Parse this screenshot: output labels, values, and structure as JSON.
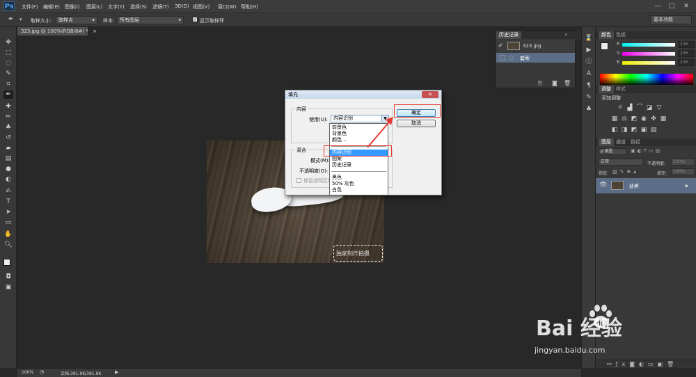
{
  "app": {
    "logo": "Ps",
    "menu": [
      "文件(F)",
      "编辑(E)",
      "图像(I)",
      "图层(L)",
      "文字(Y)",
      "选择(S)",
      "滤镜(T)",
      "3D(D)",
      "视图(V)",
      "窗口(W)",
      "帮助(H)"
    ],
    "window_controls": [
      "—",
      "□",
      "✕"
    ]
  },
  "options_bar": {
    "sample_size_label": "取样大小:",
    "sample_size_value": "取样点",
    "sample_label": "样本:",
    "sample_value": "所有图层",
    "show_ring_label": "显示取样环",
    "show_ring_checked": true,
    "workspace": "基本功能"
  },
  "document": {
    "tab_label": "323.jpg @ 100%(RGB/8#) *",
    "tab_close": "×",
    "image_watermark": "独家制作拍摄"
  },
  "history_panel": {
    "tab": "历史记录",
    "snapshot": "323.jpg",
    "items": [
      "套索"
    ]
  },
  "color_panel": {
    "tabs": [
      "颜色",
      "色板"
    ],
    "channels": [
      {
        "label": "R",
        "value": "236"
      },
      {
        "label": "G",
        "value": "236"
      },
      {
        "label": "B",
        "value": "236"
      }
    ]
  },
  "adjustments_panel": {
    "tabs": [
      "调整",
      "样式"
    ],
    "title": "添加调整"
  },
  "layers_panel": {
    "tabs": [
      "图层",
      "通道",
      "路径"
    ],
    "kind_label": "p 类型",
    "blend_mode": "正常",
    "opacity_label": "不透明度:",
    "opacity_value": "100%",
    "lock_label": "锁定:",
    "fill_label": "填充:",
    "fill_value": "100%",
    "layer_name": "背景"
  },
  "status_bar": {
    "zoom": "100%",
    "doc_info": "文档:391.9K/391.9K"
  },
  "fill_dialog": {
    "title": "填充",
    "close": "✕",
    "content_group": "内容",
    "use_label": "使用(U):",
    "use_value": "内容识别",
    "blend_group": "混合",
    "mode_label": "模式(M):",
    "opacity_label": "不透明度(O):",
    "preserve_label": "保留透明区域",
    "ok_button": "确定",
    "cancel_button": "取消",
    "dropdown_options": [
      "前景色",
      "背景色",
      "颜色...",
      "内容识别",
      "图案",
      "历史记录",
      "黑色",
      "50% 灰色",
      "白色"
    ],
    "selected_option": "内容识别"
  },
  "watermark": {
    "logo_text": "Bai  经验",
    "url": "jingyan.baidu.com"
  }
}
